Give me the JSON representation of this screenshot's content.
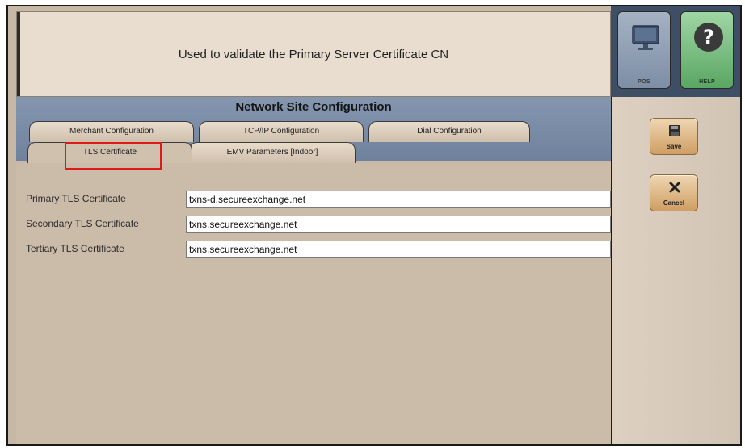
{
  "info": {
    "message": "Used to validate the Primary Server Certificate CN"
  },
  "top_buttons": {
    "pos_label": "POS",
    "help_label": "HELP"
  },
  "page": {
    "title": "Network Site Configuration"
  },
  "tabs": {
    "row1": [
      "Merchant Configuration",
      "TCP/IP Configuration",
      "Dial Configuration"
    ],
    "row2": [
      "TLS Certificate",
      "EMV Parameters [Indoor]"
    ],
    "active": "TLS Certificate"
  },
  "fields": [
    {
      "label": "Primary TLS Certificate",
      "value": "txns-d.secureexchange.net"
    },
    {
      "label": "Secondary TLS Certificate",
      "value": "txns.secureexchange.net"
    },
    {
      "label": "Tertiary TLS Certificate",
      "value": "txns.secureexchange.net"
    }
  ],
  "sidebar": {
    "save_label": "Save",
    "cancel_label": "Cancel"
  },
  "colors": {
    "highlight": "#e01818",
    "title_strip": "#7a8ca6",
    "panel": "#c8b8a6"
  }
}
